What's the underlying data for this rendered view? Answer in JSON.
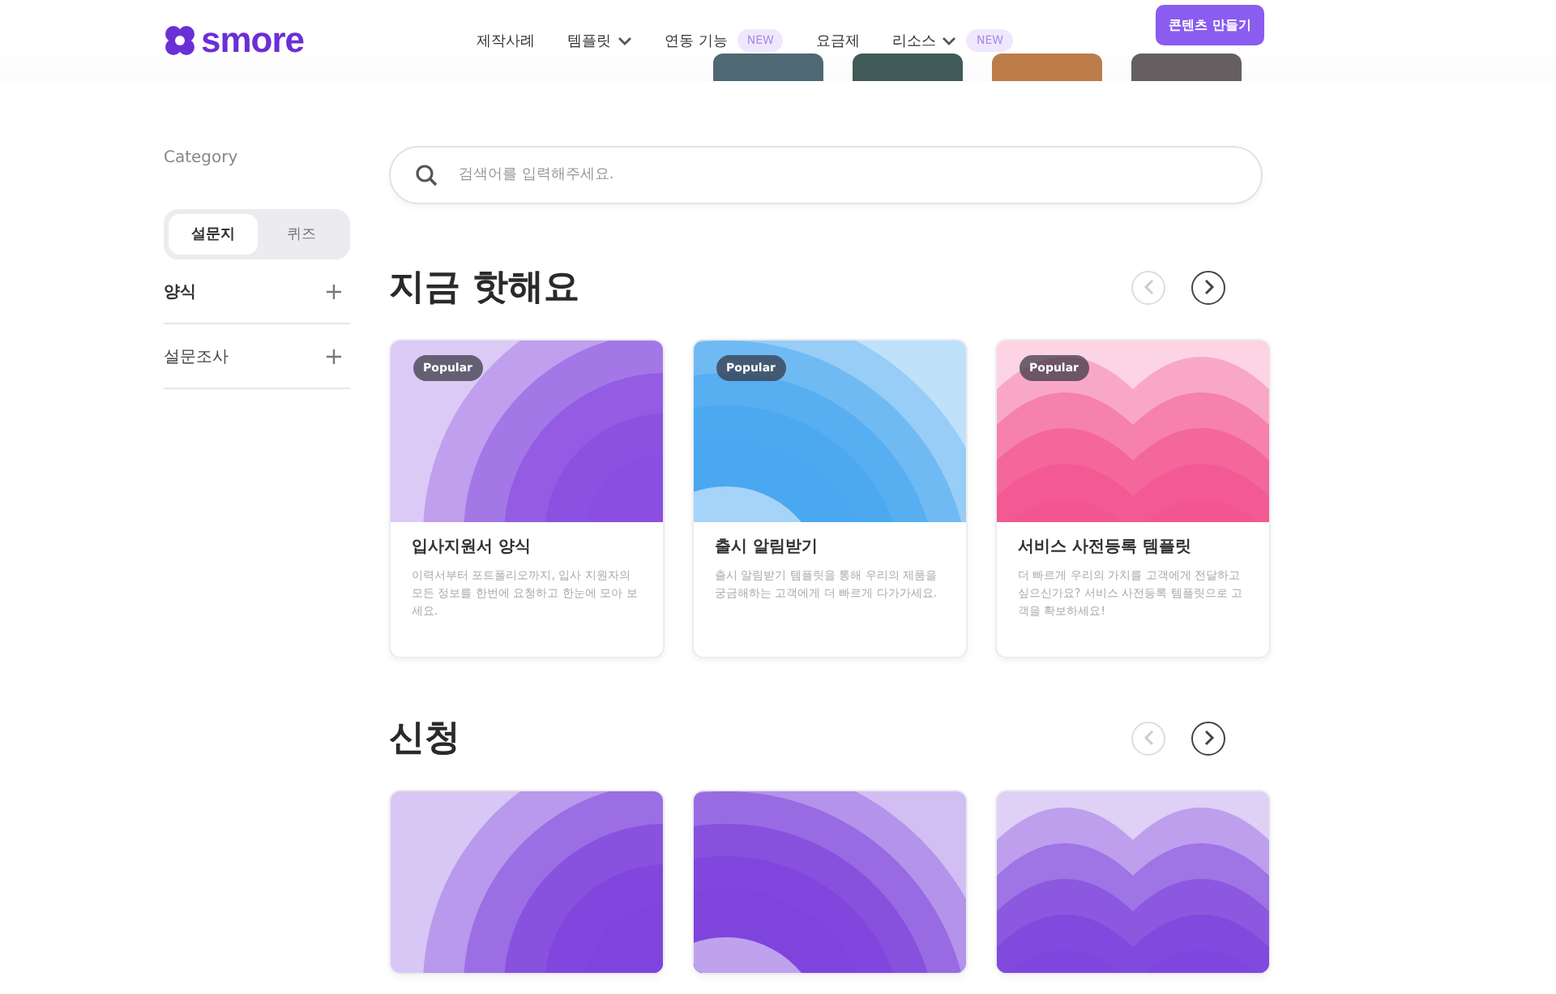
{
  "header": {
    "logo": "smore",
    "nav": [
      {
        "label": "제작사례",
        "dropdown": false
      },
      {
        "label": "템플릿",
        "dropdown": true
      },
      {
        "label": "연동 기능",
        "dropdown": false,
        "badge": "NEW"
      },
      {
        "label": "요금제",
        "dropdown": false
      },
      {
        "label": "리소스",
        "dropdown": true,
        "badge": "NEW"
      }
    ],
    "cta": "콘텐츠 만들기"
  },
  "sidebar": {
    "title": "Category",
    "tabs": [
      {
        "label": "설문지",
        "selected": true
      },
      {
        "label": "퀴즈",
        "selected": false
      }
    ],
    "items": [
      {
        "label": "양식",
        "bold": true
      },
      {
        "label": "설문조사",
        "bold": false
      }
    ]
  },
  "search": {
    "placeholder": "검색어를 입력해주세요."
  },
  "sections": [
    {
      "title": "지금 핫해요",
      "prev_disabled": true,
      "cards": [
        {
          "badge": "Popular",
          "art": {
            "kind": "scallop",
            "color": "#8a4fe0"
          },
          "title": "입사지원서 양식",
          "description": "이력서부터 포트폴리오까지, 입사 지원자의 모든 정보를 한번에 요청하고 한눈에 모아 보세요."
        },
        {
          "badge": "Popular",
          "art": {
            "kind": "rings",
            "color": "#4aa8f0"
          },
          "title": "출시 알림받기",
          "description": "출시 알림받기 템플릿을 통해 우리의 제품을 궁금해하는 고객에게 더 빠르게 다가가세요."
        },
        {
          "badge": "Popular",
          "art": {
            "kind": "hearts",
            "color": "#f2558f"
          },
          "title": "서비스 사전등록 템플릿",
          "description": "더 빠르게 우리의 가치를 고객에게 전달하고 싶으신가요? 서비스 사전등록 템플릿으로 고객을 확보하세요!"
        }
      ]
    },
    {
      "title": "신청",
      "prev_disabled": true,
      "cards": [
        {
          "art": {
            "kind": "scallop",
            "color": "#7e44dc"
          }
        },
        {
          "art": {
            "kind": "rings",
            "color": "#7e44dc"
          }
        },
        {
          "art": {
            "kind": "hearts",
            "color": "#7e44dc"
          }
        }
      ]
    }
  ]
}
